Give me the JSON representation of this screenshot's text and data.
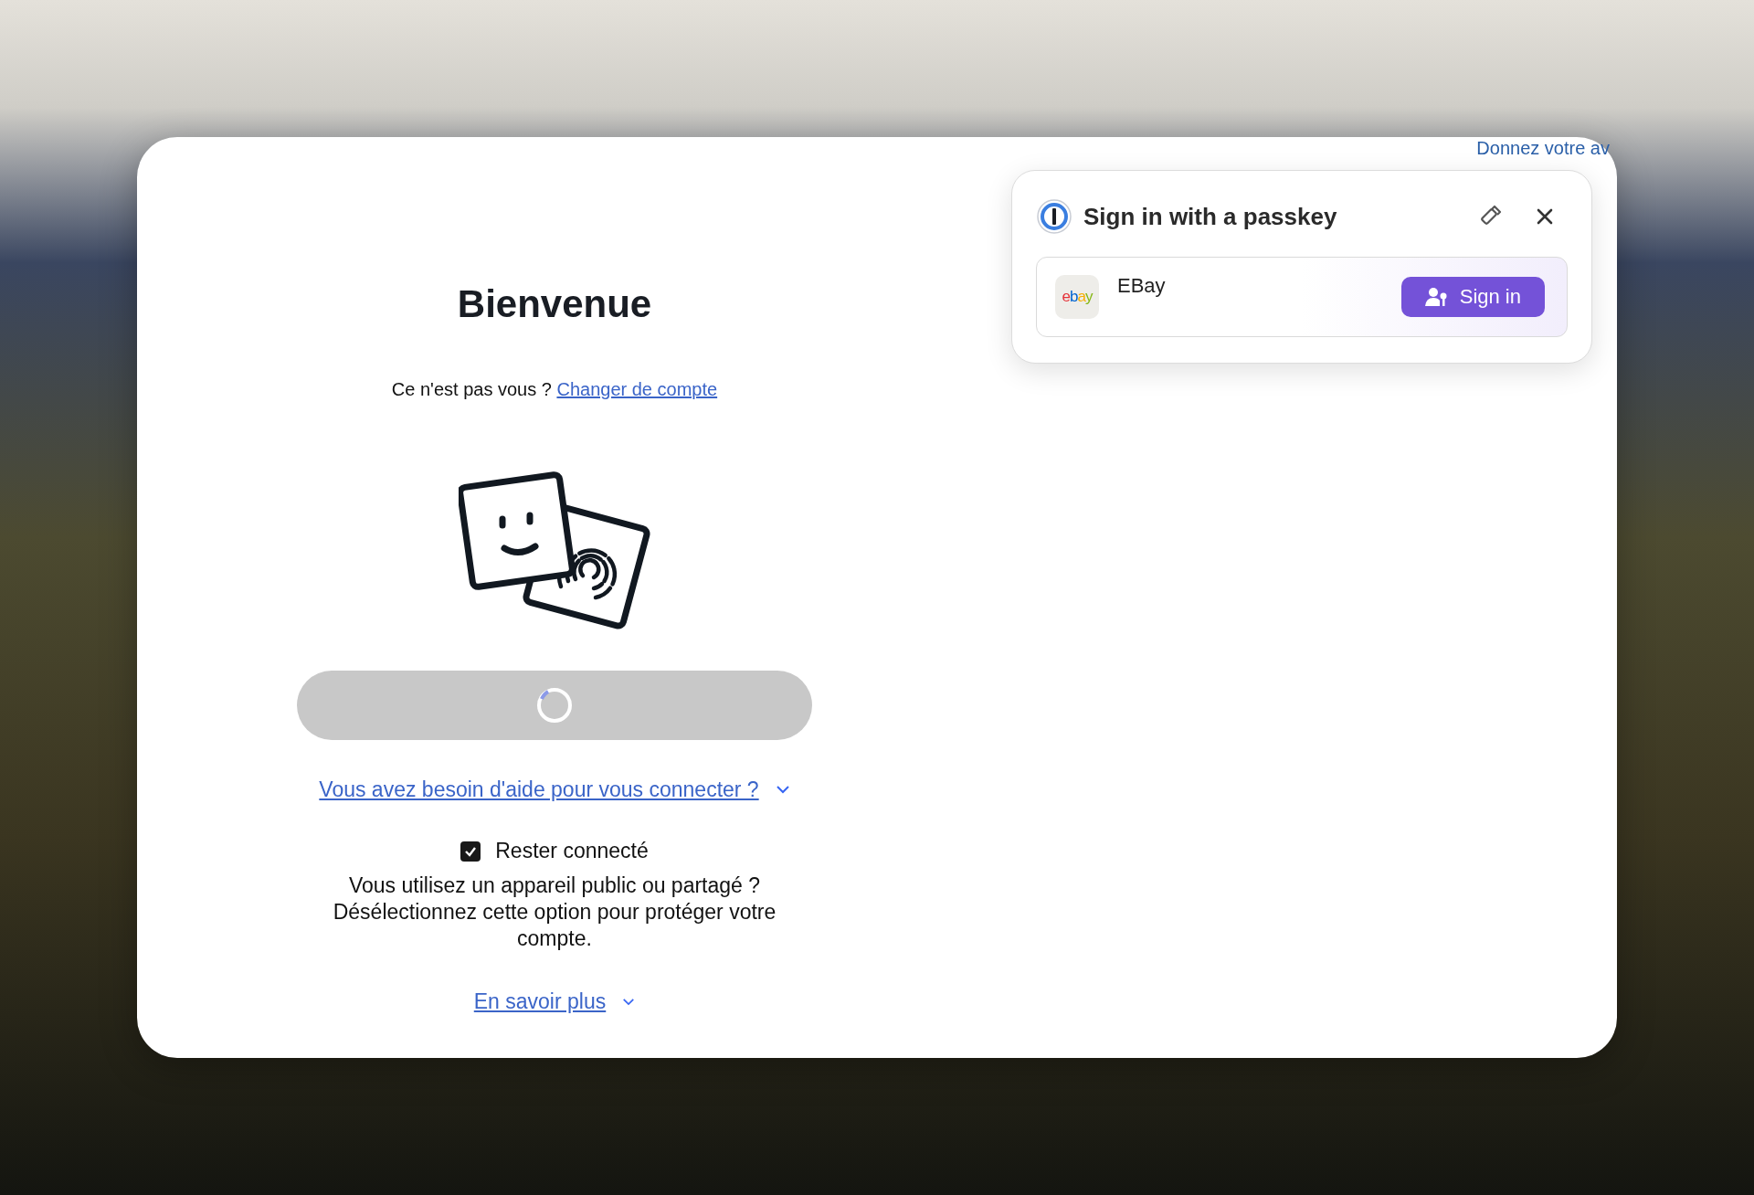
{
  "feedback_link": "Donnez votre av",
  "login": {
    "title": "Bienvenue",
    "not_you": "Ce n'est pas vous ?",
    "switch_link": "Changer de compte",
    "continue_button": {
      "loading": true
    },
    "help_link": "Vous avez besoin d'aide pour vous connecter ?",
    "stay_signed_in": {
      "label": "Rester connecté",
      "checked": true
    },
    "notice": "Vous utilisez un appareil public ou partagé ? Désélectionnez cette option pour protéger votre compte.",
    "learn_more": "En savoir plus"
  },
  "passkey_popup": {
    "title": "Sign in with a passkey",
    "accounts": [
      {
        "logo": "ebay",
        "name": "EBay",
        "button": "Sign in"
      }
    ]
  }
}
